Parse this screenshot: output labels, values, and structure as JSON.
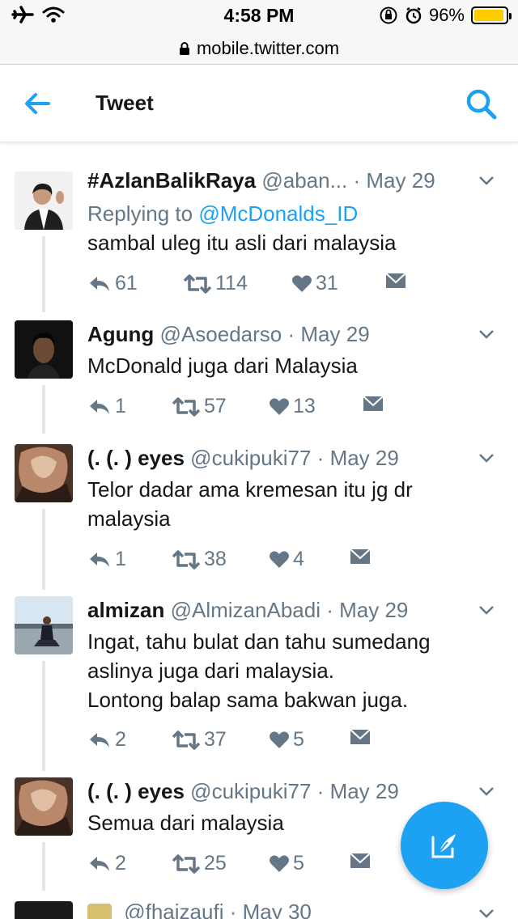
{
  "status_bar": {
    "time": "4:58 PM",
    "battery_percent": "96%",
    "battery_level": 0.96,
    "icons": [
      "airplane-icon",
      "wifi-icon",
      "orientation-lock-icon",
      "alarm-icon",
      "battery-icon"
    ]
  },
  "url_bar": {
    "url": "mobile.twitter.com",
    "icon": "lock-icon"
  },
  "header": {
    "title": "Tweet",
    "back_icon": "back-arrow-icon",
    "search_icon": "search-icon"
  },
  "accent_color": "#1da1f2",
  "tweets": [
    {
      "name": "#AzlanBalikRaya",
      "handle": "@aban...",
      "date": "May 29",
      "replying_prefix": "Replying to",
      "replying_to": "@McDonalds_ID",
      "text": [
        "sambal uleg itu asli dari malaysia"
      ],
      "replies": "61",
      "retweets": "114",
      "likes": "31"
    },
    {
      "name": "Agung",
      "handle": "@Asoedarso",
      "date": "May 29",
      "text": [
        "McDonald juga dari Malaysia"
      ],
      "replies": "1",
      "retweets": "57",
      "likes": "13"
    },
    {
      "name": "(. (. ) eyes",
      "handle": "@cukipuki77",
      "date": "May 29",
      "text": [
        "Telor dadar ama kremesan itu jg dr",
        "malaysia"
      ],
      "replies": "1",
      "retweets": "38",
      "likes": "4"
    },
    {
      "name": "almizan",
      "handle": "@AlmizanAbadi",
      "date": "May 29",
      "text": [
        "Ingat, tahu bulat dan tahu sumedang",
        "aslinya juga dari malaysia.",
        "Lontong balap sama bakwan juga."
      ],
      "replies": "2",
      "retweets": "37",
      "likes": "5"
    },
    {
      "name": "(. (. ) eyes",
      "handle": "@cukipuki77",
      "date": "May 29",
      "text": [
        "Semua dari malaysia"
      ],
      "replies": "2",
      "retweets": "25",
      "likes": "5"
    },
    {
      "name": "",
      "handle": "@fhaizaufi",
      "date": "May 30"
    }
  ],
  "dot_separator": "·",
  "compose_icon": "compose-tweet-icon"
}
